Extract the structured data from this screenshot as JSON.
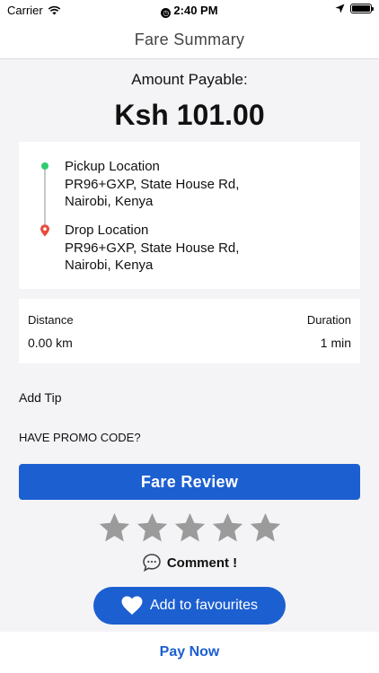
{
  "status_bar": {
    "carrier": "Carrier",
    "time": "2:40 PM",
    "icons": [
      "wifi-icon",
      "alarm-icon",
      "location-arrow-icon",
      "battery-icon"
    ],
    "battery_level": 1.0
  },
  "nav": {
    "title": "Fare Summary"
  },
  "fare": {
    "amount_label": "Amount Payable:",
    "amount_value": "Ksh 101.00"
  },
  "route": {
    "pickup": {
      "title": "Pickup Location",
      "address": "PR96+GXP, State House Rd,\nNairobi, Kenya"
    },
    "drop": {
      "title": "Drop Location",
      "address": "PR96+GXP, State House Rd,\nNairobi, Kenya"
    }
  },
  "trip_info": {
    "distance_label": "Distance",
    "distance_value": "0.00 km",
    "duration_label": "Duration",
    "duration_value": "1 min"
  },
  "add_tip": "Add Tip",
  "promo": "HAVE PROMO CODE?",
  "fare_review_button": "Fare Review",
  "rating": {
    "max": 5,
    "value": 0
  },
  "comment": "Comment !",
  "favourites_button": "Add to favourites",
  "pay_now": "Pay Now",
  "colors": {
    "accent": "#1c5fd0",
    "pickup_dot": "#2ecc71",
    "drop_pin": "#e74c3c",
    "star_empty": "#9b9b9b",
    "background": "#f4f4f6"
  }
}
